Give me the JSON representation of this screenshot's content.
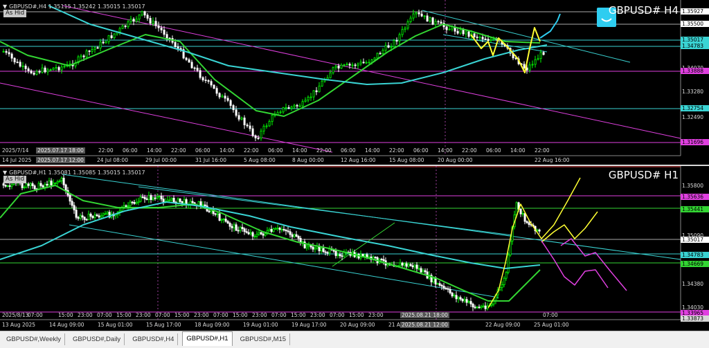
{
  "top_panel": {
    "title": "GBPUSD# H4",
    "info": "GBPUSD#,H4  1.35115 1.35242 1.35015 1.35017",
    "hide_label": "As Hid",
    "price_labels": [
      {
        "text": "1.35927",
        "color": "#ffffff",
        "highlight": true
      },
      {
        "text": "1.35500",
        "color": "#ffffff",
        "highlight": true
      },
      {
        "text": "1.35017",
        "color": "#3ad4d4",
        "highlight": true
      },
      {
        "text": "1.34783",
        "color": "#3ad4d4",
        "highlight": true
      },
      {
        "text": "1.34070",
        "color": null,
        "highlight": false
      },
      {
        "text": "1.33888",
        "color": "#e040e0",
        "highlight": true
      },
      {
        "text": "1.33280",
        "color": null,
        "highlight": false
      },
      {
        "text": "1.32754",
        "color": "#3ad4d4",
        "highlight": true
      },
      {
        "text": "1.32490",
        "color": null,
        "highlight": false
      },
      {
        "text": "1.31696",
        "color": "#e040e0",
        "highlight": true
      }
    ],
    "time_labels": [
      "14 Jul 2025",
      "21 Jul 16:00",
      "24 Jul 08:00",
      "29 Jul 00:00",
      "31 Jul 16:00",
      "5 Aug 08:00",
      "8 Aug 00:00",
      "12 Aug 16:00",
      "15 Aug 08:00",
      "20 Aug 00:00",
      "22 Aug 16:00"
    ],
    "crosshair_labels": [
      "2025/7/14",
      "2025.07.17 18:00",
      "2025.07.17 12:00"
    ],
    "upper_time_labels": [
      "22:00",
      "06:00",
      "14:00",
      "22:00",
      "06:00",
      "14:00",
      "22:00",
      "06:00",
      "14:00",
      "22:00",
      "06:00",
      "14:00",
      "22:00",
      "06:00",
      "14:00",
      "22:00",
      "06:00",
      "14:00",
      "22:00"
    ]
  },
  "bottom_panel": {
    "title": "GBPUSD# H1",
    "info": "GBPUSD#,H1  1.35081 1.35085 1.35015 1.35017",
    "hide_label": "As Hid",
    "price_labels": [
      {
        "text": "1.35800",
        "color": null,
        "highlight": false
      },
      {
        "text": "1.35636",
        "color": "#e040e0",
        "highlight": true
      },
      {
        "text": "1.35441",
        "color": "#33d633",
        "highlight": true
      },
      {
        "text": "1.35090",
        "color": null,
        "highlight": false
      },
      {
        "text": "1.35017",
        "color": "#ffffff",
        "highlight": true
      },
      {
        "text": "1.34783",
        "color": "#3ad4d4",
        "highlight": true
      },
      {
        "text": "1.34669",
        "color": "#33d633",
        "highlight": true
      },
      {
        "text": "1.34380",
        "color": null,
        "highlight": false
      },
      {
        "text": "1.34030",
        "color": null,
        "highlight": false
      },
      {
        "text": "1.33965",
        "color": "#e040e0",
        "highlight": true
      },
      {
        "text": "1.33873",
        "color": "#d8d8d8",
        "highlight": true
      }
    ],
    "time_labels": [
      "13 Aug 2025",
      "14 Aug 09:00",
      "15 Aug 01:00",
      "15 Aug 17:00",
      "18 Aug 09:00",
      "19 Aug 01:00",
      "19 Aug 17:00",
      "20 Aug 09:00",
      "21 Aug",
      "22 Aug 09:00",
      "25 Aug 01:00"
    ],
    "crosshair_labels": [
      "2025/8/13",
      "2025.08.21 18:00",
      "2025.08.21 12:00"
    ],
    "upper_time_labels": [
      "07:00",
      "15:00",
      "23:00",
      "07:00",
      "15:00",
      "23:00",
      "07:00",
      "15:00",
      "23:00",
      "07:00",
      "15:00",
      "23:00",
      "07:00",
      "15:00",
      "23:00",
      "07:00",
      "15:00",
      "23:00",
      "07:00"
    ]
  },
  "tabs": [
    "GBPUSD#,Weekly",
    "GBPUSD#,Daily",
    "GBPUSD#,H4",
    "GBPUSD#,H1",
    "GBPUSD#,M15"
  ],
  "active_tab": "GBPUSD#,H1",
  "icons": {
    "emoji": "smiley-icon"
  },
  "colors": {
    "background": "#000000",
    "bull_candle": "#00ff00",
    "bear_candle": "#ffffff",
    "ma_fast": "#33d633",
    "ma_slow": "#3ad4d4",
    "channel_magenta": "#e040e0",
    "forecast_yellow": "#ffff33"
  }
}
